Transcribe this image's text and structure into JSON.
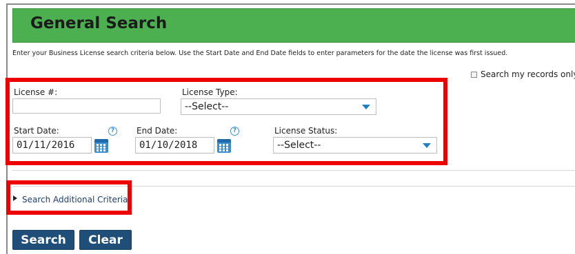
{
  "header": {
    "title": "General Search"
  },
  "instructions": "Enter your Business License search criteria below.  Use the Start Date and End Date fields to enter parameters for the date the license was first issued.",
  "my_records": {
    "label": "Search my records only",
    "checked": false
  },
  "fields": {
    "license_number": {
      "label": "License #:",
      "value": ""
    },
    "license_type": {
      "label": "License Type:",
      "selected": "--Select--"
    },
    "start_date": {
      "label": "Start Date:",
      "value": "01/11/2016"
    },
    "end_date": {
      "label": "End Date:",
      "value": "01/10/2018"
    },
    "license_status": {
      "label": "License Status:",
      "selected": "--Select--"
    }
  },
  "additional_criteria": {
    "label": "Search Additional Criteria"
  },
  "buttons": {
    "search": "Search",
    "clear": "Clear"
  },
  "icons": {
    "help": "?",
    "help_name": "help-icon",
    "calendar_name": "calendar-icon",
    "dropdown_name": "chevron-down-icon",
    "expander_name": "triangle-right-icon"
  },
  "colors": {
    "header_green": "#4caf50",
    "button_blue": "#1f4e79",
    "highlight_red": "#ee0000",
    "accent_blue": "#3a8fd0"
  }
}
